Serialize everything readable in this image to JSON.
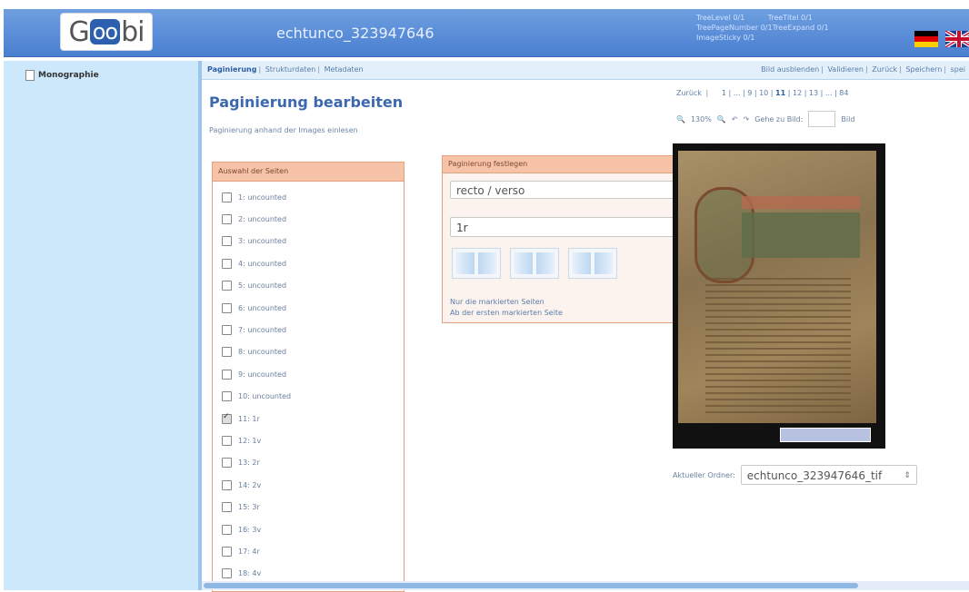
{
  "header": {
    "logo_text": "Goobi",
    "process_title": "echtunco_323947646",
    "tree_info": [
      "TreeLevel 0/1",
      "TreeTitel 0/1",
      "TreePageNumber 0/1TreeExpand 0/1",
      "ImageSticky 0/1"
    ]
  },
  "sidebar": {
    "root_label": "Monographie"
  },
  "toolbar": {
    "tabs": [
      "Paginierung",
      "Strukturdaten",
      "Metadaten"
    ],
    "actions": [
      "Bild ausblenden",
      "Validieren",
      "Zurück",
      "Speichern",
      "spei"
    ]
  },
  "main": {
    "heading": "Paginierung bearbeiten",
    "subheading": "Paginierung anhand der Images einlesen"
  },
  "selection": {
    "title": "Auswahl der Seiten",
    "pages": [
      {
        "label": "1: uncounted",
        "checked": false
      },
      {
        "label": "2: uncounted",
        "checked": false
      },
      {
        "label": "3: uncounted",
        "checked": false
      },
      {
        "label": "4: uncounted",
        "checked": false
      },
      {
        "label": "5: uncounted",
        "checked": false
      },
      {
        "label": "6: uncounted",
        "checked": false
      },
      {
        "label": "7: uncounted",
        "checked": false
      },
      {
        "label": "8: uncounted",
        "checked": false
      },
      {
        "label": "9: uncounted",
        "checked": false
      },
      {
        "label": "10: uncounted",
        "checked": false
      },
      {
        "label": "11: 1r",
        "checked": true
      },
      {
        "label": "12: 1v",
        "checked": false
      },
      {
        "label": "13: 2r",
        "checked": false
      },
      {
        "label": "14: 2v",
        "checked": false
      },
      {
        "label": "15: 3r",
        "checked": false
      },
      {
        "label": "16: 3v",
        "checked": false
      },
      {
        "label": "17: 4r",
        "checked": false
      },
      {
        "label": "18: 4v",
        "checked": false
      }
    ]
  },
  "pagination": {
    "title": "Paginierung festlegen",
    "type_value": "recto / verso",
    "start_value": "1r",
    "link_marked": "Nur die markierten Seiten",
    "link_from_first": "Ab der ersten markierten Seite"
  },
  "image_nav": {
    "back": "Zurück",
    "pages": "1 | ... | 9 | 10 |",
    "current": "11",
    "pages_after": "| 12 | 13 | ... | 84",
    "zoom": "130%",
    "goto_label": "Gehe zu Bild:",
    "image_label": "Bild"
  },
  "folder": {
    "label": "Aktueller Ordner:",
    "value": "echtunco_323947646_tif"
  },
  "colors": {
    "header_blue": "#4a7fd0",
    "sidebar_bg": "#cde7fb",
    "panel_header": "#f6c2a8",
    "link_blue": "#5a7da8"
  }
}
